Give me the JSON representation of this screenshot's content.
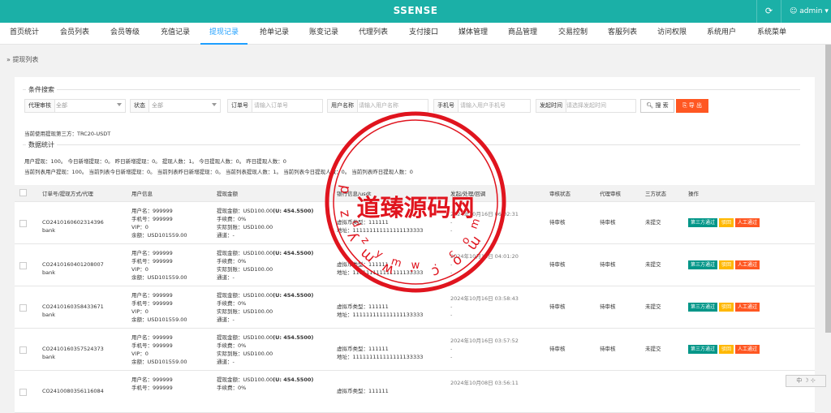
{
  "app": {
    "title": "SSENSE",
    "refresh_icon": "refresh-icon",
    "user": "admin"
  },
  "menu": [
    {
      "label": "首页统计"
    },
    {
      "label": "会员列表"
    },
    {
      "label": "会员等级"
    },
    {
      "label": "充值记录"
    },
    {
      "label": "提现记录"
    },
    {
      "label": "抢单记录"
    },
    {
      "label": "账变记录"
    },
    {
      "label": "代理列表"
    },
    {
      "label": "支付接口"
    },
    {
      "label": "媒体管理"
    },
    {
      "label": "商品管理"
    },
    {
      "label": "交易控制"
    },
    {
      "label": "客服列表"
    },
    {
      "label": "访问权限"
    },
    {
      "label": "系统用户"
    },
    {
      "label": "系统菜单"
    }
  ],
  "breadcrumb": "» 提现列表",
  "search": {
    "legend": "条件搜索",
    "agent_label": "代理审核",
    "agent_value": "全部",
    "status_label": "状态",
    "status_value": "全部",
    "order_label": "订单号",
    "order_placeholder": "请输入订单号",
    "username_label": "用户名称",
    "username_placeholder": "请输入用户名称",
    "phone_label": "手机号",
    "phone_placeholder": "请输入用户手机号",
    "time_label": "发起时间",
    "time_placeholder": "请选择发起时间",
    "search_button": "搜 索",
    "export_button": "导 出"
  },
  "third_party_text": "当前使用提现第三方：TRC20-USDT",
  "stats": {
    "legend": "数据统计",
    "line1": "用户提现：100。 今日新增提现：0。 昨日新增提现：0。 提现人数：1。 今日提现人数：0。 昨日提现人数：0",
    "line2": "当前列表用户提现：100。 当前列表今日新增提现：0。 当前列表昨日新增提现：0。 当前列表提现人数：1。 当前列表今日提现人数：0。 当前列表昨日提现人数：0"
  },
  "table": {
    "headers": [
      "订单号/提现方式/代理",
      "用户信息",
      "提现金额",
      "银行信息/usdt",
      "发起/处理/回调",
      "审核状态",
      "代理审核",
      "三方状态",
      "操作"
    ],
    "rows": [
      {
        "order": "CO2410160602314396",
        "method": "bank",
        "user": [
          "用户名：999999",
          "手机号：999999",
          "VIP：0",
          "余额：USD101559.00"
        ],
        "amount_label": "提现金额：USD100.00",
        "amount_u": "(U: 454.5500)",
        "amount_rest": [
          "手续费：0%",
          "实际到账：USD100.00",
          "通道：-"
        ],
        "bank": [
          "虚拟币类型：111111",
          "地址：111111111111111133333"
        ],
        "times": [
          "2024年10月16日 06:02:31",
          "-",
          "-"
        ],
        "audit": "待审核",
        "agent": "待审核",
        "third": "未提交",
        "ops": [
          "第三方通过",
          "驳回",
          "人工通过"
        ]
      },
      {
        "order": "CO2410160401208007",
        "method": "bank",
        "user": [
          "用户名：999999",
          "手机号：999999",
          "VIP：0",
          "余额：USD101559.00"
        ],
        "amount_label": "提现金额：USD100.00",
        "amount_u": "(U: 454.5500)",
        "amount_rest": [
          "手续费：0%",
          "实际到账：USD100.00",
          "通道：-"
        ],
        "bank": [
          "虚拟币类型：111111",
          "地址：111111111111111133333"
        ],
        "times": [
          "2024年10月16日 04:01:20",
          "-",
          "-"
        ],
        "audit": "待审核",
        "agent": "待审核",
        "third": "未提交",
        "ops": [
          "第三方通过",
          "驳回",
          "人工通过"
        ]
      },
      {
        "order": "CO2410160358433671",
        "method": "bank",
        "user": [
          "用户名：999999",
          "手机号：999999",
          "VIP：0",
          "余额：USD101559.00"
        ],
        "amount_label": "提现金额：USD100.00",
        "amount_u": "(U: 454.5500)",
        "amount_rest": [
          "手续费：0%",
          "实际到账：USD100.00",
          "通道：-"
        ],
        "bank": [
          "虚拟币类型：111111",
          "地址：111111111111111133333"
        ],
        "times": [
          "2024年10月16日 03:58:43",
          "-",
          "-"
        ],
        "audit": "待审核",
        "agent": "待审核",
        "third": "未提交",
        "ops": [
          "第三方通过",
          "驳回",
          "人工通过"
        ]
      },
      {
        "order": "CO2410160357524373",
        "method": "bank",
        "user": [
          "用户名：999999",
          "手机号：999999",
          "VIP：0",
          "余额：USD101559.00"
        ],
        "amount_label": "提现金额：USD100.00",
        "amount_u": "(U: 454.5500)",
        "amount_rest": [
          "手续费：0%",
          "实际到账：USD100.00",
          "通道：-"
        ],
        "bank": [
          "虚拟币类型：111111",
          "地址：111111111111111133333"
        ],
        "times": [
          "2024年10月16日 03:57:52",
          "-",
          "-"
        ],
        "audit": "待审核",
        "agent": "待审核",
        "third": "未提交",
        "ops": [
          "第三方通过",
          "驳回",
          "人工通过"
        ]
      },
      {
        "order": "CO2410080356116084",
        "method": "",
        "user": [
          "用户名：999999",
          "手机号：999999"
        ],
        "amount_label": "提现金额：USD100.00",
        "amount_u": "(U: 454.5500)",
        "amount_rest": [
          "手续费：0%"
        ],
        "bank": [
          "虚拟币类型：111111"
        ],
        "times": [
          "2024年10月08日 03:56:11"
        ],
        "audit": "",
        "agent": "",
        "third": "",
        "ops": []
      }
    ]
  },
  "watermark": {
    "title": "道臻源码网",
    "ring": "dzymw.com",
    "color": "#e0141e"
  },
  "colors": {
    "topbar": "#1bb0a7",
    "active_tab": "#1e9fff",
    "export": "#ff5722"
  }
}
